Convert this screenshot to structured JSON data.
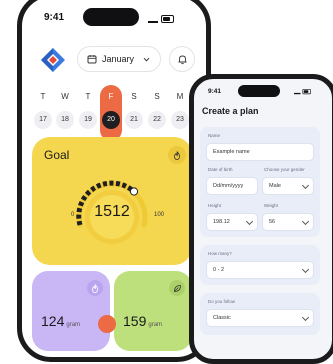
{
  "left_phone": {
    "status_time": "9:41",
    "month_selector": {
      "value": "January"
    },
    "week": {
      "days": [
        {
          "letter": "T",
          "number": "17"
        },
        {
          "letter": "W",
          "number": "18"
        },
        {
          "letter": "T",
          "number": "19"
        },
        {
          "letter": "F",
          "number": "20"
        },
        {
          "letter": "S",
          "number": "21"
        },
        {
          "letter": "S",
          "number": "22"
        },
        {
          "letter": "M",
          "number": "23"
        }
      ],
      "active_index": 3
    },
    "goal_card": {
      "title": "Goal",
      "value": "1512",
      "gauge_min": "0",
      "gauge_max": "100"
    },
    "stat_cards": [
      {
        "value": "124",
        "unit": "gram"
      },
      {
        "value": "159",
        "unit": "gram"
      }
    ],
    "colors": {
      "accent": "#ec6a44",
      "goal_card": "#f5d74f",
      "purple_card": "#c9b6f5",
      "green_card": "#bde07c"
    }
  },
  "right_phone": {
    "status_time": "9:41",
    "title": "Create a plan",
    "name": {
      "label": "Name",
      "value": "Example name"
    },
    "dob": {
      "label": "Date of birth",
      "value": "Dd/mm/yyyy"
    },
    "gender": {
      "label": "Choose your gender",
      "value": "Male"
    },
    "height": {
      "label": "Height",
      "value": "198.12"
    },
    "weight": {
      "label": "Weight",
      "value": "56"
    },
    "how_many": {
      "label": "How many?",
      "value": "0 - 2"
    },
    "follow": {
      "label": "Do you follow",
      "value": "Classic"
    }
  }
}
